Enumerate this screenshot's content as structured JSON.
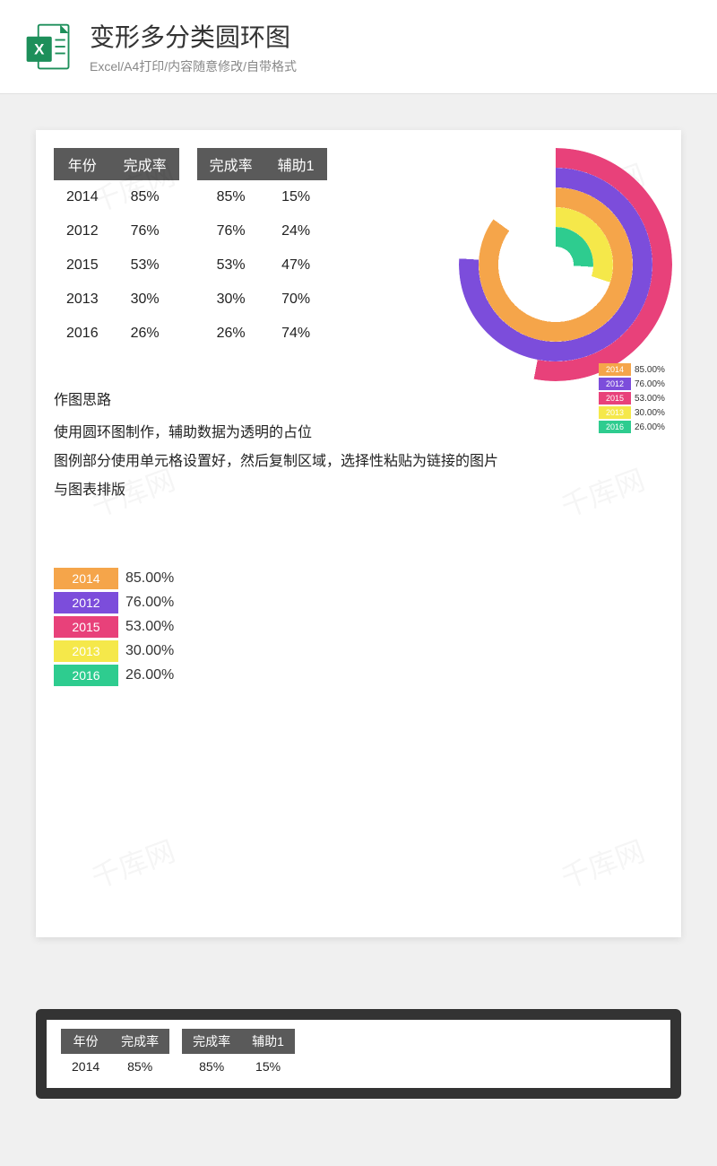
{
  "header": {
    "title": "变形多分类圆环图",
    "subtitle": "Excel/A4打印/内容随意修改/自带格式"
  },
  "table1": {
    "headers": [
      "年份",
      "完成率"
    ],
    "rows": [
      [
        "2014",
        "85%"
      ],
      [
        "2012",
        "76%"
      ],
      [
        "2015",
        "53%"
      ],
      [
        "2013",
        "30%"
      ],
      [
        "2016",
        "26%"
      ]
    ]
  },
  "table2": {
    "headers": [
      "完成率",
      "辅助1"
    ],
    "rows": [
      [
        "85%",
        "15%"
      ],
      [
        "76%",
        "24%"
      ],
      [
        "53%",
        "47%"
      ],
      [
        "30%",
        "70%"
      ],
      [
        "26%",
        "74%"
      ]
    ]
  },
  "notes": {
    "title": "作图思路",
    "lines": [
      "使用圆环图制作，辅助数据为透明的占位",
      "图例部分使用单元格设置好，然后复制区域，选择性粘贴为链接的图片",
      "与图表排版"
    ]
  },
  "legend": {
    "items": [
      {
        "year": "2014",
        "value": "85.00%",
        "color": "#f5a54a"
      },
      {
        "year": "2012",
        "value": "76.00%",
        "color": "#7c4ddb"
      },
      {
        "year": "2015",
        "value": "53.00%",
        "color": "#e8417a"
      },
      {
        "year": "2013",
        "value": "30.00%",
        "color": "#f5e84a"
      },
      {
        "year": "2016",
        "value": "26.00%",
        "color": "#2ecc8f"
      }
    ]
  },
  "chart_data": {
    "type": "donut-multiring",
    "title": "",
    "rings": [
      {
        "label": "2014",
        "value": 85,
        "remainder": 15,
        "color": "#f5a54a"
      },
      {
        "label": "2012",
        "value": 76,
        "remainder": 24,
        "color": "#7c4ddb"
      },
      {
        "label": "2015",
        "value": 53,
        "remainder": 47,
        "color": "#e8417a"
      },
      {
        "label": "2013",
        "value": 30,
        "remainder": 70,
        "color": "#f5e84a"
      },
      {
        "label": "2016",
        "value": 26,
        "remainder": 74,
        "color": "#2ecc8f"
      }
    ],
    "note": "Each ring shows the completion rate; remainder portion is transparent spacer"
  },
  "watermark": "千库网"
}
